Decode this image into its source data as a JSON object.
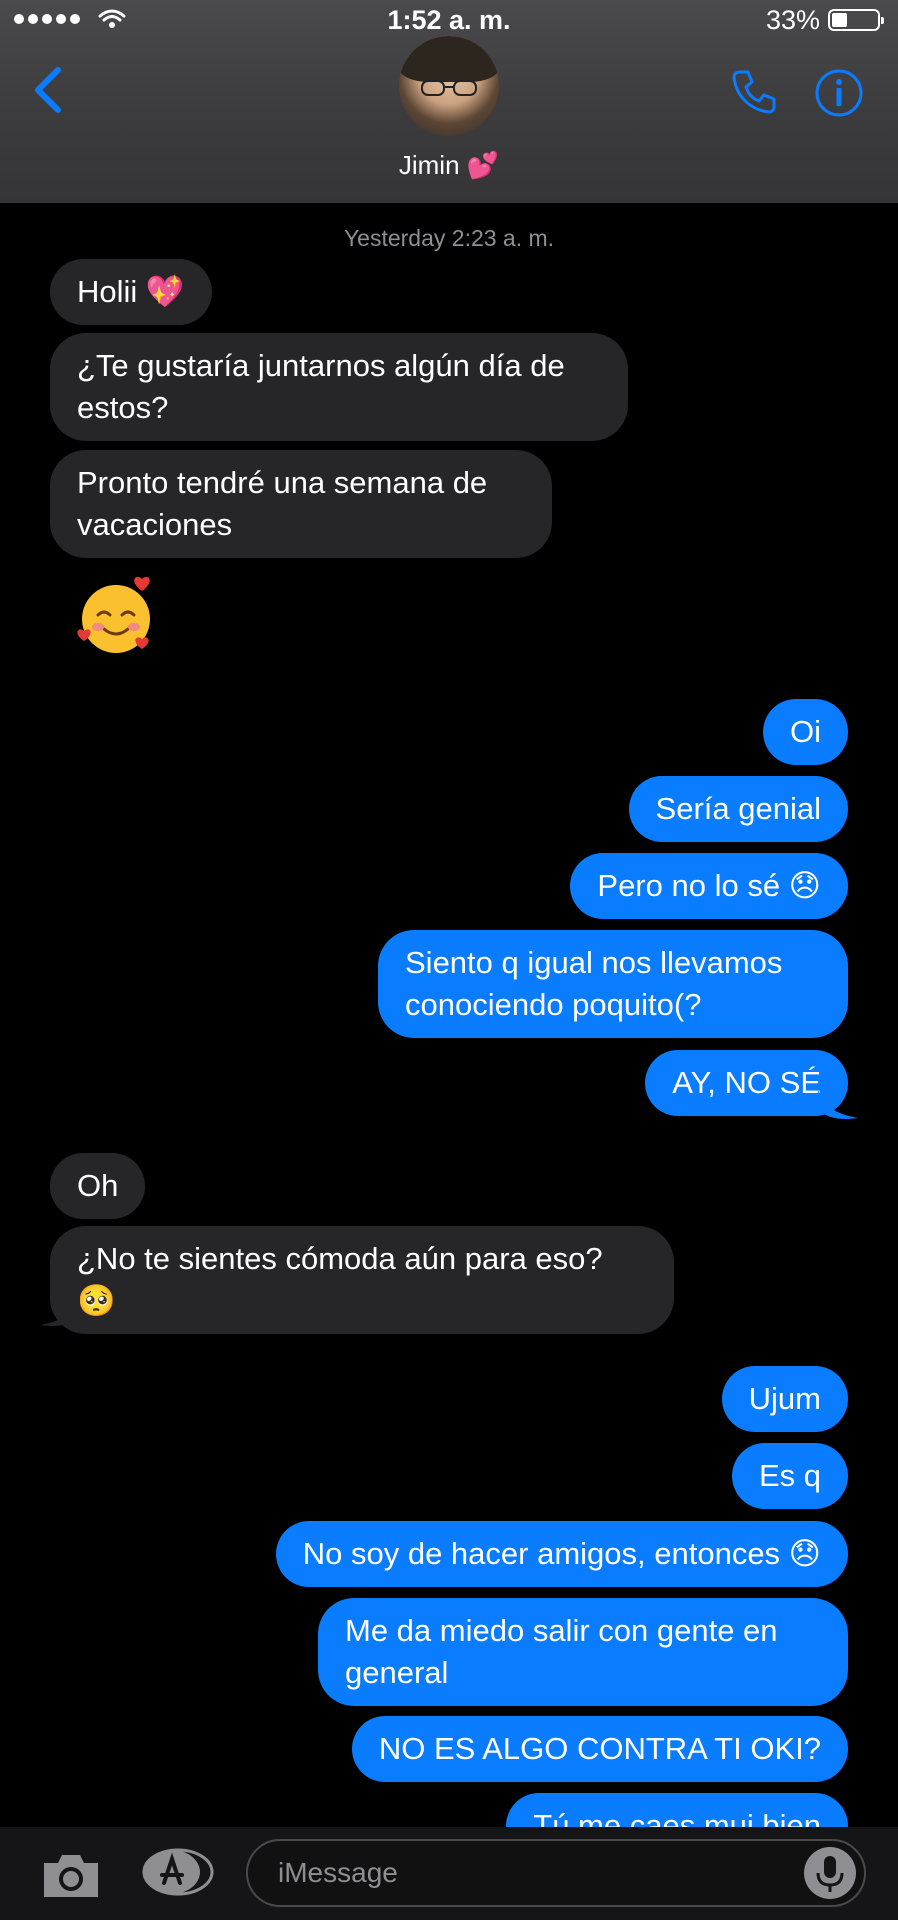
{
  "status_bar": {
    "time": "1:52 a. m.",
    "battery_percent": "33%",
    "battery_level": 0.33,
    "signal_bars": 5
  },
  "header": {
    "contact_name": "Jimin 💕"
  },
  "chat": {
    "timestamp": "Yesterday 2:23 a. m.",
    "messages": [
      {
        "from": "contact",
        "text": "Holii 💖"
      },
      {
        "from": "contact",
        "text": "¿Te gustaría juntarnos algún día de estos?"
      },
      {
        "from": "contact",
        "text": "Pronto tendré una semana de vacaciones"
      },
      {
        "from": "contact",
        "text": "🥰"
      },
      {
        "from": "me",
        "text": "Oi"
      },
      {
        "from": "me",
        "text": "Sería genial"
      },
      {
        "from": "me",
        "text": "Pero no lo sé 😞"
      },
      {
        "from": "me",
        "text": "Siento q igual nos llevamos conociendo poquito(?"
      },
      {
        "from": "me",
        "text": "AY, NO SÉ"
      },
      {
        "from": "contact",
        "text": "Oh"
      },
      {
        "from": "contact",
        "text": "¿No te sientes cómoda aún para eso? 🥺"
      },
      {
        "from": "me",
        "text": "Ujum"
      },
      {
        "from": "me",
        "text": "Es q"
      },
      {
        "from": "me",
        "text": "No soy de hacer amigos, entonces 😞"
      },
      {
        "from": "me",
        "text": "Me da miedo salir con gente en general"
      },
      {
        "from": "me",
        "text": "NO ES ALGO CONTRA TI OKI?"
      },
      {
        "from": "me",
        "text": "Tú me caes mui bien"
      }
    ]
  },
  "input": {
    "placeholder": "iMessage"
  },
  "colors": {
    "accent": "#0a7cff",
    "incoming_bubble": "#262629",
    "header_bg": "#3c3c3e"
  },
  "icons": [
    "back-chevron-icon",
    "phone-icon",
    "info-icon",
    "camera-icon",
    "app-store-icon",
    "microphone-icon"
  ]
}
